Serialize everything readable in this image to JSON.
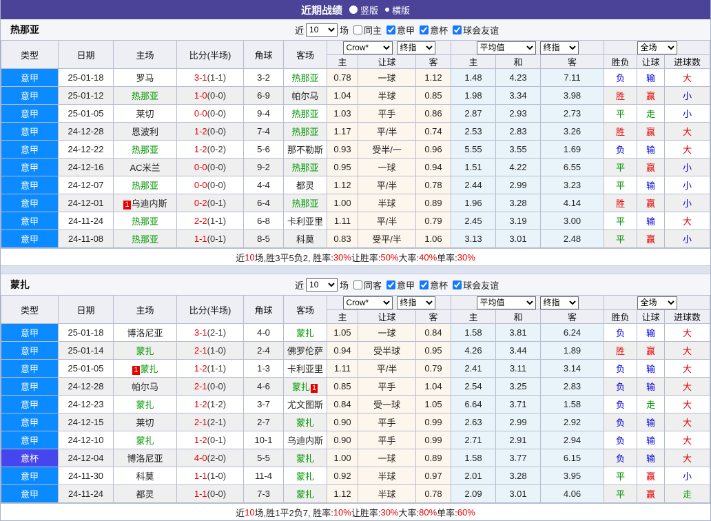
{
  "topbar": {
    "title": "近期战绩",
    "radios": [
      {
        "label": "竖版",
        "selected": false
      },
      {
        "label": "横版",
        "selected": true
      }
    ]
  },
  "colors": {
    "topbar_bg": "#4b4397",
    "league_bg": "#0b8bff",
    "cup_bg": "#4646ee",
    "win": "#e60000",
    "draw": "#009700",
    "lose": "#0000e0",
    "odds_bg": "#fdf6ec",
    "avg_bg": "#e9f4fa"
  },
  "result_colors": {
    "胜": "win",
    "平": "draw",
    "负": "lose",
    "赢": "win",
    "走": "draw",
    "输": "lose",
    "大": "win",
    "小": "lose"
  },
  "table_header": {
    "col_type": "类型",
    "col_date": "日期",
    "col_home": "主场",
    "col_score": "比分(半场)",
    "col_corner": "角球",
    "col_away": "客场",
    "col_h": "主",
    "col_handicap": "让球",
    "col_a": "客",
    "col_avg_h": "主",
    "col_avg_d": "和",
    "col_avg_a": "客",
    "col_result": "胜负",
    "col_result_handicap": "让球",
    "col_goals": "进球数",
    "select_crow": "Crow*",
    "select_final1": "终指",
    "select_avg": "平均值",
    "select_final2": "终指",
    "select_scope": "全场"
  },
  "sections": [
    {
      "team": "热那亚",
      "controls": {
        "near": "近",
        "count": "10",
        "unit": "场",
        "same": {
          "label": "同主",
          "checked": false
        },
        "filters": [
          {
            "label": "意甲",
            "checked": true
          },
          {
            "label": "意杯",
            "checked": true
          },
          {
            "label": "球会友谊",
            "checked": true
          }
        ]
      },
      "rows": [
        {
          "type": "意甲",
          "cup": false,
          "date": "25-01-18",
          "home": "罗马",
          "home_green": false,
          "home_card": "",
          "score": "3-1",
          "half": "(1-1)",
          "corner": "3-2",
          "away": "热那亚",
          "away_green": true,
          "away_card": "",
          "odds": [
            "0.78",
            "一球",
            "1.12"
          ],
          "avg": [
            "1.48",
            "4.23",
            "7.11"
          ],
          "result": [
            "负",
            "输",
            "大"
          ]
        },
        {
          "type": "意甲",
          "cup": false,
          "date": "25-01-12",
          "home": "热那亚",
          "home_green": true,
          "home_card": "",
          "score": "1-0",
          "half": "(0-0)",
          "corner": "6-9",
          "away": "帕尔马",
          "away_green": false,
          "away_card": "",
          "odds": [
            "1.04",
            "半球",
            "0.85"
          ],
          "avg": [
            "1.98",
            "3.34",
            "3.98"
          ],
          "result": [
            "胜",
            "赢",
            "小"
          ]
        },
        {
          "type": "意甲",
          "cup": false,
          "date": "25-01-05",
          "home": "莱切",
          "home_green": false,
          "home_card": "",
          "score": "0-0",
          "half": "(0-0)",
          "corner": "9-4",
          "away": "热那亚",
          "away_green": true,
          "away_card": "",
          "odds": [
            "1.03",
            "平手",
            "0.86"
          ],
          "avg": [
            "2.87",
            "2.93",
            "2.73"
          ],
          "result": [
            "平",
            "走",
            "小"
          ]
        },
        {
          "type": "意甲",
          "cup": false,
          "date": "24-12-28",
          "home": "恩波利",
          "home_green": false,
          "home_card": "",
          "score": "1-2",
          "half": "(0-0)",
          "corner": "7-4",
          "away": "热那亚",
          "away_green": true,
          "away_card": "",
          "odds": [
            "1.17",
            "平/半",
            "0.74"
          ],
          "avg": [
            "2.53",
            "2.83",
            "3.26"
          ],
          "result": [
            "胜",
            "赢",
            "大"
          ]
        },
        {
          "type": "意甲",
          "cup": false,
          "date": "24-12-22",
          "home": "热那亚",
          "home_green": true,
          "home_card": "",
          "score": "1-2",
          "half": "(0-2)",
          "corner": "5-6",
          "away": "那不勒斯",
          "away_green": false,
          "away_card": "",
          "odds": [
            "0.93",
            "受半/一",
            "0.96"
          ],
          "avg": [
            "5.55",
            "3.55",
            "1.69"
          ],
          "result": [
            "负",
            "输",
            "大"
          ]
        },
        {
          "type": "意甲",
          "cup": false,
          "date": "24-12-16",
          "home": "AC米兰",
          "home_green": false,
          "home_card": "",
          "score": "0-0",
          "half": "(0-0)",
          "corner": "9-2",
          "away": "热那亚",
          "away_green": true,
          "away_card": "",
          "odds": [
            "0.95",
            "一球",
            "0.94"
          ],
          "avg": [
            "1.51",
            "4.22",
            "6.55"
          ],
          "result": [
            "平",
            "赢",
            "小"
          ]
        },
        {
          "type": "意甲",
          "cup": false,
          "date": "24-12-07",
          "home": "热那亚",
          "home_green": true,
          "home_card": "",
          "score": "0-0",
          "half": "(0-0)",
          "corner": "4-4",
          "away": "都灵",
          "away_green": false,
          "away_card": "",
          "odds": [
            "1.12",
            "平/半",
            "0.78"
          ],
          "avg": [
            "2.44",
            "2.99",
            "3.23"
          ],
          "result": [
            "平",
            "输",
            "小"
          ]
        },
        {
          "type": "意甲",
          "cup": false,
          "date": "24-12-01",
          "home": "乌迪内斯",
          "home_green": false,
          "home_card": "1",
          "score": "0-2",
          "half": "(0-1)",
          "corner": "6-4",
          "away": "热那亚",
          "away_green": true,
          "away_card": "",
          "odds": [
            "1.00",
            "半球",
            "0.89"
          ],
          "avg": [
            "1.96",
            "3.28",
            "4.14"
          ],
          "result": [
            "胜",
            "赢",
            "小"
          ]
        },
        {
          "type": "意甲",
          "cup": false,
          "date": "24-11-24",
          "home": "热那亚",
          "home_green": true,
          "home_card": "",
          "score": "2-2",
          "half": "(1-1)",
          "corner": "6-8",
          "away": "卡利亚里",
          "away_green": false,
          "away_card": "",
          "odds": [
            "1.11",
            "平/半",
            "0.79"
          ],
          "avg": [
            "2.45",
            "3.19",
            "3.00"
          ],
          "result": [
            "平",
            "输",
            "大"
          ]
        },
        {
          "type": "意甲",
          "cup": false,
          "date": "24-11-08",
          "home": "热那亚",
          "home_green": true,
          "home_card": "",
          "score": "1-1",
          "half": "(0-1)",
          "corner": "8-5",
          "away": "科莫",
          "away_green": false,
          "away_card": "",
          "odds": [
            "0.83",
            "受平/半",
            "1.06"
          ],
          "avg": [
            "3.13",
            "3.01",
            "2.48"
          ],
          "result": [
            "平",
            "赢",
            "小"
          ]
        }
      ],
      "summary": [
        {
          "t": "近"
        },
        {
          "t": "10",
          "red": true
        },
        {
          "t": "场,胜3平5负2, 胜率:"
        },
        {
          "t": "30%",
          "red": true
        },
        {
          "t": " 让胜率:"
        },
        {
          "t": "50%",
          "red": true
        },
        {
          "t": " 大率:"
        },
        {
          "t": "40%",
          "red": true
        },
        {
          "t": " 单率:"
        },
        {
          "t": "30%",
          "red": true
        }
      ]
    },
    {
      "team": "蒙扎",
      "controls": {
        "near": "近",
        "count": "10",
        "unit": "场",
        "same": {
          "label": "同客",
          "checked": false
        },
        "filters": [
          {
            "label": "意甲",
            "checked": true
          },
          {
            "label": "意杯",
            "checked": true
          },
          {
            "label": "球会友谊",
            "checked": true
          }
        ]
      },
      "rows": [
        {
          "type": "意甲",
          "cup": false,
          "date": "25-01-18",
          "home": "博洛尼亚",
          "home_green": false,
          "home_card": "",
          "score": "3-1",
          "half": "(2-1)",
          "corner": "4-0",
          "away": "蒙扎",
          "away_green": true,
          "away_card": "",
          "odds": [
            "1.05",
            "一球",
            "0.84"
          ],
          "avg": [
            "1.58",
            "3.81",
            "6.24"
          ],
          "result": [
            "负",
            "输",
            "大"
          ]
        },
        {
          "type": "意甲",
          "cup": false,
          "date": "25-01-14",
          "home": "蒙扎",
          "home_green": true,
          "home_card": "",
          "score": "2-1",
          "half": "(1-0)",
          "corner": "2-4",
          "away": "佛罗伦萨",
          "away_green": false,
          "away_card": "",
          "odds": [
            "0.94",
            "受半球",
            "0.95"
          ],
          "avg": [
            "4.26",
            "3.44",
            "1.89"
          ],
          "result": [
            "胜",
            "赢",
            "大"
          ]
        },
        {
          "type": "意甲",
          "cup": false,
          "date": "25-01-05",
          "home": "蒙扎",
          "home_green": true,
          "home_card": "1",
          "score": "1-2",
          "half": "(1-1)",
          "corner": "1-3",
          "away": "卡利亚里",
          "away_green": false,
          "away_card": "",
          "odds": [
            "1.11",
            "平/半",
            "0.79"
          ],
          "avg": [
            "2.41",
            "3.11",
            "3.14"
          ],
          "result": [
            "负",
            "输",
            "大"
          ]
        },
        {
          "type": "意甲",
          "cup": false,
          "date": "24-12-28",
          "home": "帕尔马",
          "home_green": false,
          "home_card": "",
          "score": "2-1",
          "half": "(0-0)",
          "corner": "4-6",
          "away": "蒙扎",
          "away_green": true,
          "away_card": "1",
          "odds": [
            "0.85",
            "平手",
            "1.04"
          ],
          "avg": [
            "2.54",
            "3.25",
            "2.83"
          ],
          "result": [
            "负",
            "输",
            "大"
          ]
        },
        {
          "type": "意甲",
          "cup": false,
          "date": "24-12-23",
          "home": "蒙扎",
          "home_green": true,
          "home_card": "",
          "score": "1-2",
          "half": "(1-2)",
          "corner": "3-7",
          "away": "尤文图斯",
          "away_green": false,
          "away_card": "",
          "odds": [
            "0.84",
            "受一球",
            "1.05"
          ],
          "avg": [
            "6.64",
            "3.71",
            "1.58"
          ],
          "result": [
            "负",
            "走",
            "大"
          ]
        },
        {
          "type": "意甲",
          "cup": false,
          "date": "24-12-15",
          "home": "莱切",
          "home_green": false,
          "home_card": "",
          "score": "2-1",
          "half": "(2-1)",
          "corner": "2-7",
          "away": "蒙扎",
          "away_green": true,
          "away_card": "",
          "odds": [
            "0.90",
            "平手",
            "0.99"
          ],
          "avg": [
            "2.63",
            "2.99",
            "2.92"
          ],
          "result": [
            "负",
            "输",
            "大"
          ]
        },
        {
          "type": "意甲",
          "cup": false,
          "date": "24-12-10",
          "home": "蒙扎",
          "home_green": true,
          "home_card": "",
          "score": "1-2",
          "half": "(0-1)",
          "corner": "10-1",
          "away": "乌迪内斯",
          "away_green": false,
          "away_card": "",
          "odds": [
            "0.90",
            "平手",
            "0.99"
          ],
          "avg": [
            "2.71",
            "2.91",
            "2.94"
          ],
          "result": [
            "负",
            "输",
            "大"
          ]
        },
        {
          "type": "意杯",
          "cup": true,
          "date": "24-12-04",
          "home": "博洛尼亚",
          "home_green": false,
          "home_card": "",
          "score": "4-0",
          "half": "(2-0)",
          "corner": "5-5",
          "away": "蒙扎",
          "away_green": true,
          "away_card": "",
          "odds": [
            "1.00",
            "一球",
            "0.89"
          ],
          "avg": [
            "1.58",
            "3.77",
            "6.15"
          ],
          "result": [
            "负",
            "输",
            "大"
          ]
        },
        {
          "type": "意甲",
          "cup": false,
          "date": "24-11-30",
          "home": "科莫",
          "home_green": false,
          "home_card": "",
          "score": "1-1",
          "half": "(1-0)",
          "corner": "11-4",
          "away": "蒙扎",
          "away_green": true,
          "away_card": "",
          "odds": [
            "0.92",
            "半球",
            "0.97"
          ],
          "avg": [
            "2.01",
            "3.28",
            "3.95"
          ],
          "result": [
            "平",
            "赢",
            "小"
          ]
        },
        {
          "type": "意甲",
          "cup": false,
          "date": "24-11-24",
          "home": "都灵",
          "home_green": false,
          "home_card": "",
          "score": "1-1",
          "half": "(0-0)",
          "corner": "7-3",
          "away": "蒙扎",
          "away_green": true,
          "away_card": "",
          "odds": [
            "1.12",
            "半球",
            "0.78"
          ],
          "avg": [
            "2.09",
            "3.01",
            "4.06"
          ],
          "result": [
            "平",
            "赢",
            "走"
          ]
        }
      ],
      "summary": [
        {
          "t": "近"
        },
        {
          "t": "10",
          "red": true
        },
        {
          "t": "场,胜1平2负7, 胜率:"
        },
        {
          "t": "10%",
          "red": true
        },
        {
          "t": " 让胜率:"
        },
        {
          "t": "30%",
          "red": true
        },
        {
          "t": " 大率:"
        },
        {
          "t": "80%",
          "red": true
        },
        {
          "t": " 单率:"
        },
        {
          "t": "60%",
          "red": true
        }
      ]
    }
  ]
}
